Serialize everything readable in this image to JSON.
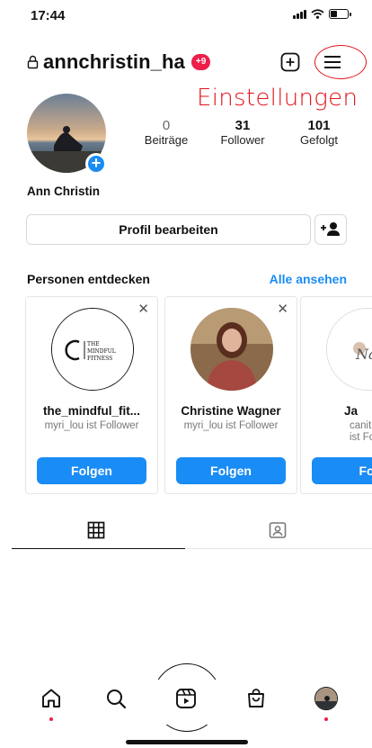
{
  "status_bar": {
    "time": "17:44"
  },
  "header": {
    "username": "annchristin_ha",
    "notification_badge": "+9"
  },
  "annotation": {
    "label": "Einstellungen"
  },
  "profile": {
    "display_name": "Ann Christin",
    "stats": [
      {
        "count": "0",
        "label": "Beiträge"
      },
      {
        "count": "31",
        "label": "Follower"
      },
      {
        "count": "101",
        "label": "Gefolgt"
      }
    ],
    "edit_button": "Profil bearbeiten"
  },
  "discover": {
    "heading": "Personen entdecken",
    "see_all": "Alle ansehen",
    "cards": [
      {
        "name": "the_mindful_fit...",
        "subtitle": "myri_lou ist Follower",
        "follow": "Folgen",
        "logo_text": "THE MINDFUL FITNESS"
      },
      {
        "name": "Christine Wagner",
        "subtitle": "myri_lou ist Follower",
        "follow": "Folgen"
      },
      {
        "name": "Ja",
        "subtitle": "canit",
        "subtitle2": "ist Fo",
        "follow": "Fo",
        "logo_text": "Nay"
      }
    ]
  },
  "colors": {
    "accent_blue": "#1a8cf5",
    "badge_red": "#ed1f4a",
    "annotation_red": "#e2141a"
  },
  "icons": [
    "lock-icon",
    "add-post-icon",
    "menu-icon",
    "grid-icon",
    "tagged-icon",
    "home-icon",
    "search-icon",
    "reels-icon",
    "shop-icon"
  ]
}
